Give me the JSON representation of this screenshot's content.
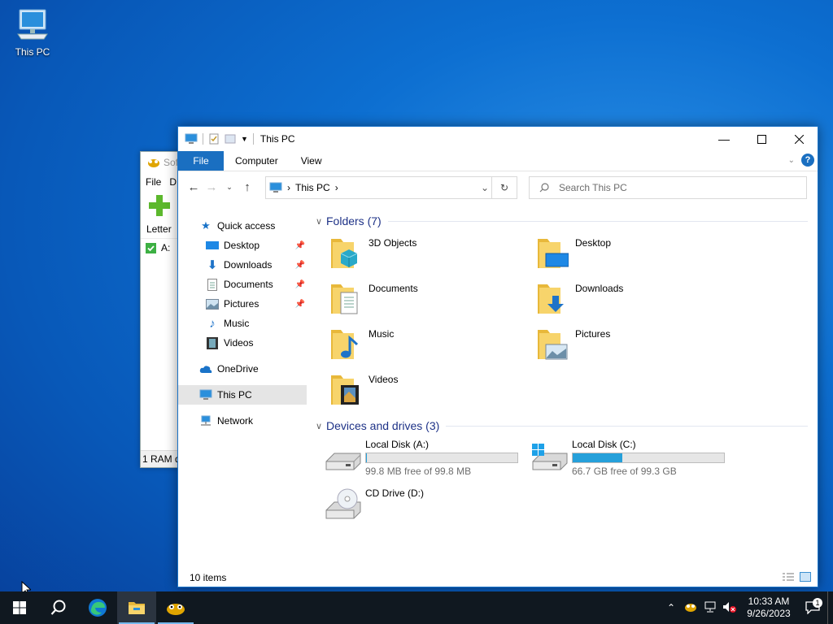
{
  "desktop": {
    "icon_label": "This PC"
  },
  "bg_window": {
    "title": "Sof",
    "menu": [
      "File",
      "D"
    ],
    "column_header": "Letter",
    "row_label": "A:",
    "status": "1 RAM d"
  },
  "explorer": {
    "title": "This PC",
    "ribbon": {
      "file": "File",
      "computer": "Computer",
      "view": "View"
    },
    "address": {
      "segment": "This PC"
    },
    "search": {
      "placeholder": "Search This PC"
    },
    "sidebar": {
      "quick_access": "Quick access",
      "items": [
        {
          "label": "Desktop",
          "pinned": true
        },
        {
          "label": "Downloads",
          "pinned": true
        },
        {
          "label": "Documents",
          "pinned": true
        },
        {
          "label": "Pictures",
          "pinned": true
        },
        {
          "label": "Music",
          "pinned": false
        },
        {
          "label": "Videos",
          "pinned": false
        }
      ],
      "onedrive": "OneDrive",
      "thispc": "This PC",
      "network": "Network"
    },
    "folders_header": "Folders (7)",
    "folders": [
      "3D Objects",
      "Desktop",
      "Documents",
      "Downloads",
      "Music",
      "Pictures",
      "Videos"
    ],
    "drives_header": "Devices and drives (3)",
    "drives": [
      {
        "name": "Local Disk (A:)",
        "free": "99.8 MB free of 99.8 MB",
        "used_fraction": 0.002
      },
      {
        "name": "Local Disk (C:)",
        "free": "66.7 GB free of 99.3 GB",
        "used_fraction": 0.33
      },
      {
        "name": "CD Drive (D:)"
      }
    ],
    "status": "10 items"
  },
  "taskbar": {
    "time": "10:33 AM",
    "date": "9/26/2023",
    "notification_count": "1"
  },
  "colors": {
    "accent": "#1a6fc1",
    "drive_bar": "#26a0da",
    "taskbar": "#101820"
  }
}
